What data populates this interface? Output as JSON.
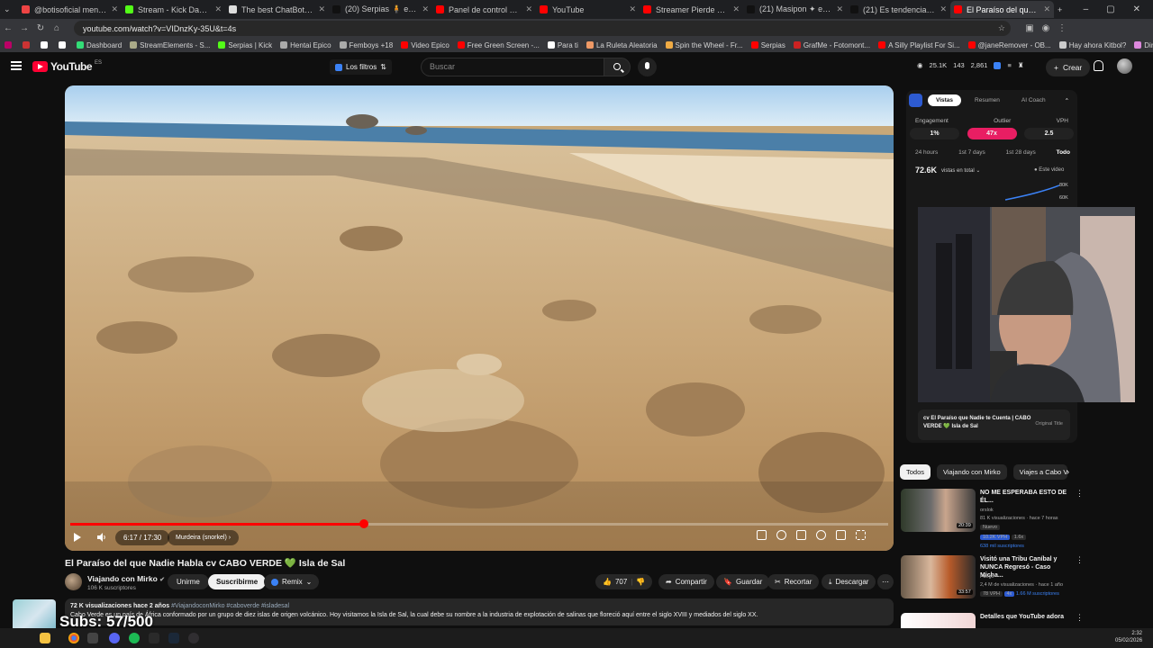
{
  "browser": {
    "tabs": [
      {
        "title": "@botisoficial mentioned",
        "color": "#e44"
      },
      {
        "title": "Stream - Kick Dashboard",
        "color": "#53fc18"
      },
      {
        "title": "The best ChatBot and Widget",
        "color": "#ddd"
      },
      {
        "title": "(20) Serpias 🧍 en X: \"APREN",
        "color": "#111"
      },
      {
        "title": "Panel de control del canal - Y",
        "color": "#f00"
      },
      {
        "title": "YouTube",
        "color": "#f00"
      },
      {
        "title": "Streamer Pierde Su Empresa",
        "color": "#f00"
      },
      {
        "title": "(21) Masipon ✦ en X: \"@ben",
        "color": "#111"
      },
      {
        "title": "(21) Es tendencia en X en X",
        "color": "#111"
      },
      {
        "title": "El Paraíso del que Nadie Habl",
        "color": "#f00",
        "active": true
      }
    ],
    "url": "youtube.com/watch?v=VIDnzKy-35U&t=4s",
    "bookmarks": [
      {
        "label": "",
        "color": "#b06"
      },
      {
        "label": "",
        "color": "#c33"
      },
      {
        "label": "",
        "color": "#fff"
      },
      {
        "label": "",
        "color": "#fff"
      },
      {
        "label": "Dashboard",
        "color": "#3d7"
      },
      {
        "label": "StreamElements - S...",
        "color": "#aa8"
      },
      {
        "label": "Serpias | Kick",
        "color": "#53fc18"
      },
      {
        "label": "Hentai Epico",
        "color": "#aaa"
      },
      {
        "label": "Femboys +18",
        "color": "#aaa"
      },
      {
        "label": "Video Epico",
        "color": "#f00"
      },
      {
        "label": "Free Green Screen -...",
        "color": "#f00"
      },
      {
        "label": "Para ti",
        "color": "#fff"
      },
      {
        "label": "La Ruleta Aleatoria",
        "color": "#e96"
      },
      {
        "label": "Spin the Wheel - Fr...",
        "color": "#ea4"
      },
      {
        "label": "Serpias",
        "color": "#f00"
      },
      {
        "label": "GrafMe - Fotomont...",
        "color": "#c22"
      },
      {
        "label": "A Silly Playlist For Si...",
        "color": "#f00"
      },
      {
        "label": "@janeRemover - OB...",
        "color": "#f00"
      },
      {
        "label": "Hay ahora Kitbol?",
        "color": "#ccc"
      },
      {
        "label": "Dirge of the Sky | C...",
        "color": "#d8d"
      },
      {
        "label": "Progreso del servicio",
        "color": "#aaa"
      }
    ]
  },
  "header": {
    "logo_text": "YouTube",
    "region": "ES",
    "filters_label": "Los filtros",
    "search_placeholder": "Buscar",
    "stats": [
      "25.1K",
      "143",
      "2,861"
    ],
    "create_label": "Crear"
  },
  "player": {
    "time": "6:17 / 17:30",
    "chapter": "Murdeira (snorkel)",
    "progress": 0.359
  },
  "video": {
    "title": "El Paraíso del que Nadie Habla cv CABO VERDE 💚 Isla de Sal",
    "channel": "Viajando con Mirko",
    "subscribers": "106 K suscriptores",
    "join_label": "Unirme",
    "subscribe_label": "Suscribirme",
    "remix_label": "Remix",
    "likes": "707",
    "share_label": "Compartir",
    "save_label": "Guardar",
    "clip_label": "Recortar",
    "download_label": "Descargar",
    "description_meta": "72 K visualizaciones  hace 2 años",
    "description_tags": "#ViajandoconMirko #caboverde #isladesal",
    "description_text": "Cabo Verde es un país de África conformado por un grupo de diez islas de origen volcánico. Hoy visitamos la Isla de Sal, la cual debe su nombre a la industria de explotación de salinas que floreció aquí entre el siglo XVIII y mediados del siglo XX."
  },
  "overlay": {
    "subs_text": "Subs: 57/500"
  },
  "panel": {
    "tabs": [
      "Vistas",
      "Resumen",
      "AI Coach"
    ],
    "metric_labels": [
      "Engagement",
      "Outlier",
      "VPH"
    ],
    "metric_values": [
      "1%",
      "47x",
      "2.5"
    ],
    "ranges": [
      "24 hours",
      "1st 7 days",
      "1st 28 days",
      "Todo"
    ],
    "total_views": "72.6K",
    "views_label": "vistas en total",
    "this_video": "Este video",
    "axis": [
      "80K",
      "60K"
    ],
    "now_title": "cv El Paraíso que Nadie te Cuenta | CABO VERDE 💚 Isla de Sal",
    "original_title": "Original Title"
  },
  "chips": [
    "Todos",
    "Viajando con Mirko",
    "Viajes a Cabo Ver"
  ],
  "recommendations": [
    {
      "title": "NO ME ESPERABA ESTO DE ÉL...",
      "channel": "orslok",
      "meta": "81 K visualizaciones · hace 7 horas",
      "badge": "Nuevo",
      "vph": "10.2K VPH",
      "mult": "1.6x",
      "subs": "638 mil suscriptores",
      "duration": "20:39"
    },
    {
      "title": "Visitó una Tribu Caníbal y NUNCA Regresó - Caso Micha...",
      "channel": "Fuego",
      "meta": "2,4 M de visualizaciones · hace 1 año",
      "badge": "",
      "vph": "78 VPH",
      "mult": "4x",
      "subs": "1.66 M suscriptores",
      "duration": "33:57"
    },
    {
      "title": "Detalles que YouTube adora",
      "channel": "",
      "meta": "",
      "badge": "",
      "vph": "",
      "mult": "",
      "subs": "",
      "duration": ""
    }
  ],
  "clock": {
    "time": "2:32",
    "date": "05/02/2026"
  }
}
